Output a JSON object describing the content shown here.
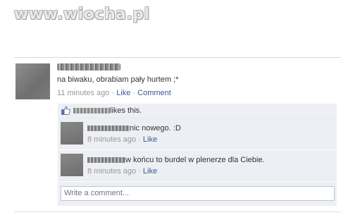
{
  "watermark": "www.wiocha.pl",
  "post": {
    "text": "na biwaku, obrabiam pały hurtem ;*",
    "time": "11 minutes ago",
    "sep": " · ",
    "like_label": "Like",
    "comment_label": "Comment"
  },
  "likes": {
    "text": "likes this."
  },
  "comments": [
    {
      "text": "nic nowego. :D",
      "time": "8 minutes ago",
      "like_label": "Like"
    },
    {
      "text": "w końcu to burdel w plenerze dla Ciebie.",
      "time": "8 minutes ago",
      "like_label": "Like"
    }
  ],
  "comment_box": {
    "placeholder": "Write a comment..."
  },
  "colors": {
    "link": "#3b5998",
    "panel": "#edeff4",
    "meta": "#999999"
  }
}
